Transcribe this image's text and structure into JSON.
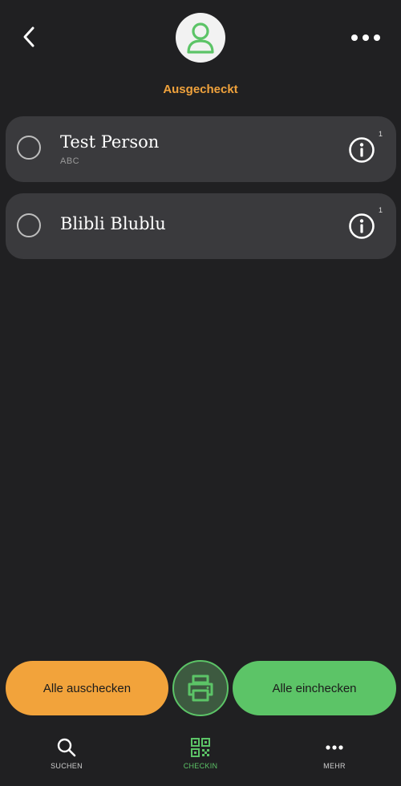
{
  "header": {
    "back_icon": "chevron-left-icon",
    "avatar_icon": "person-icon",
    "more_icon": "ellipsis-icon",
    "status": "Ausgecheckt",
    "status_color": "#f0a23c"
  },
  "persons": [
    {
      "name": "Test Person",
      "subtitle": "ABC",
      "badge": "1",
      "checked": false
    },
    {
      "name": "Blibli Blublu",
      "subtitle": "",
      "badge": "1",
      "checked": false
    }
  ],
  "actions": {
    "checkout_all": "Alle auschecken",
    "checkin_all": "Alle einchecken",
    "print_icon": "printer-icon",
    "checkout_color": "#f2a33b",
    "checkin_color": "#5cc467"
  },
  "nav": {
    "items": [
      {
        "label": "SUCHEN",
        "icon": "search-icon",
        "active": false
      },
      {
        "label": "CHECKIN",
        "icon": "qr-code-icon",
        "active": true
      },
      {
        "label": "MEHR",
        "icon": "ellipsis-icon",
        "active": false
      }
    ]
  }
}
